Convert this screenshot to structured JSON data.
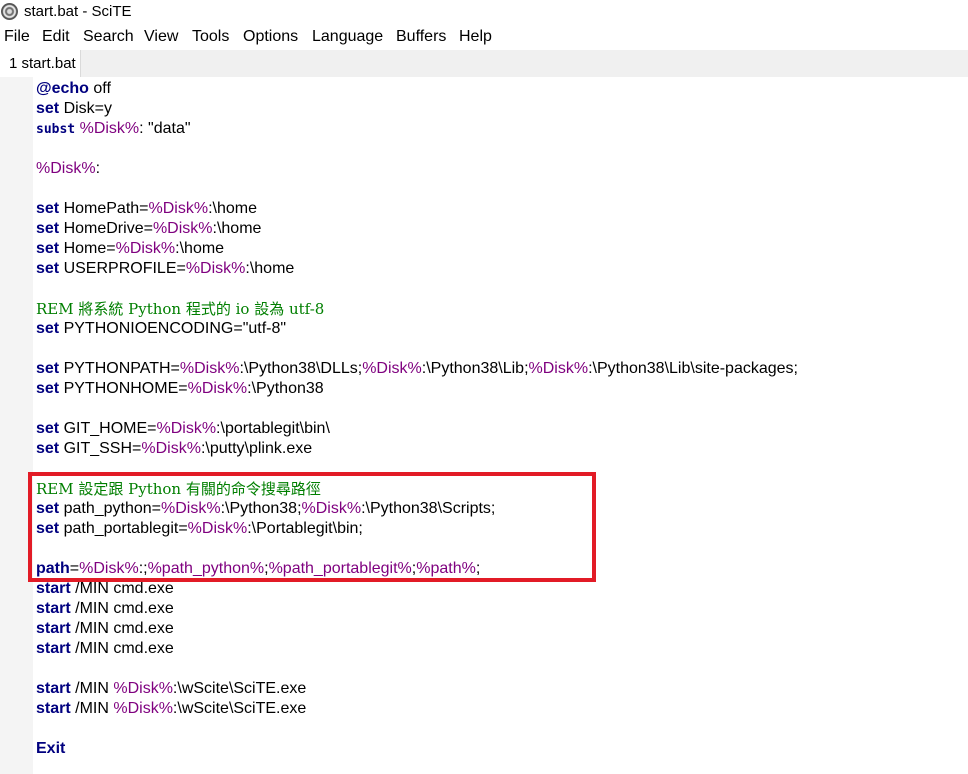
{
  "window": {
    "title": "start.bat - SciTE"
  },
  "menu": {
    "file": "File",
    "edit": "Edit",
    "search": "Search",
    "view": "View",
    "tools": "Tools",
    "options": "Options",
    "language": "Language",
    "buffers": "Buffers",
    "help": "Help"
  },
  "tabs": [
    {
      "label": "1 start.bat"
    }
  ],
  "code": [
    [
      [
        "kw",
        "@echo"
      ],
      [
        "t",
        " off"
      ]
    ],
    [
      [
        "kw",
        "set"
      ],
      [
        "t",
        " Disk=y"
      ]
    ],
    [
      [
        "kw sub",
        "subst"
      ],
      [
        "t",
        " "
      ],
      [
        "var",
        "%Disk%"
      ],
      [
        "t",
        ": \"data\""
      ]
    ],
    [],
    [
      [
        "var",
        "%Disk%"
      ],
      [
        "t",
        ":"
      ]
    ],
    [],
    [
      [
        "kw",
        "set"
      ],
      [
        "t",
        " HomePath="
      ],
      [
        "var",
        "%Disk%"
      ],
      [
        "t",
        ":\\home"
      ]
    ],
    [
      [
        "kw",
        "set"
      ],
      [
        "t",
        " HomeDrive="
      ],
      [
        "var",
        "%Disk%"
      ],
      [
        "t",
        ":\\home"
      ]
    ],
    [
      [
        "kw",
        "set"
      ],
      [
        "t",
        " Home="
      ],
      [
        "var",
        "%Disk%"
      ],
      [
        "t",
        ":\\home"
      ]
    ],
    [
      [
        "kw",
        "set"
      ],
      [
        "t",
        " USERPROFILE="
      ],
      [
        "var",
        "%Disk%"
      ],
      [
        "t",
        ":\\home"
      ]
    ],
    [],
    [
      [
        "rem",
        "REM 將系統 Python 程式的 io 設為 utf-8"
      ]
    ],
    [
      [
        "kw",
        "set"
      ],
      [
        "t",
        " PYTHONIOENCODING=\"utf-8\""
      ]
    ],
    [],
    [
      [
        "kw",
        "set"
      ],
      [
        "t",
        " PYTHONPATH="
      ],
      [
        "var",
        "%Disk%"
      ],
      [
        "t",
        ":\\Python38\\DLLs;"
      ],
      [
        "var",
        "%Disk%"
      ],
      [
        "t",
        ":\\Python38\\Lib;"
      ],
      [
        "var",
        "%Disk%"
      ],
      [
        "t",
        ":\\Python38\\Lib\\site-packages;"
      ]
    ],
    [
      [
        "kw",
        "set"
      ],
      [
        "t",
        " PYTHONHOME="
      ],
      [
        "var",
        "%Disk%"
      ],
      [
        "t",
        ":\\Python38"
      ]
    ],
    [],
    [
      [
        "kw",
        "set"
      ],
      [
        "t",
        " GIT_HOME="
      ],
      [
        "var",
        "%Disk%"
      ],
      [
        "t",
        ":\\portablegit\\bin\\"
      ]
    ],
    [
      [
        "kw",
        "set"
      ],
      [
        "t",
        " GIT_SSH="
      ],
      [
        "var",
        "%Disk%"
      ],
      [
        "t",
        ":\\putty\\plink.exe"
      ]
    ],
    [],
    [
      [
        "rem",
        "REM 設定跟 Python 有關的命令搜尋路徑"
      ]
    ],
    [
      [
        "kw",
        "set"
      ],
      [
        "t",
        " path_python="
      ],
      [
        "var",
        "%Disk%"
      ],
      [
        "t",
        ":\\Python38;"
      ],
      [
        "var",
        "%Disk%"
      ],
      [
        "t",
        ":\\Python38\\Scripts;"
      ]
    ],
    [
      [
        "kw",
        "set"
      ],
      [
        "t",
        " path_portablegit="
      ],
      [
        "var",
        "%Disk%"
      ],
      [
        "t",
        ":\\Portablegit\\bin;"
      ]
    ],
    [],
    [
      [
        "kw",
        "path"
      ],
      [
        "t",
        "="
      ],
      [
        "var",
        "%Disk%"
      ],
      [
        "t",
        ":;"
      ],
      [
        "var",
        "%path_python%"
      ],
      [
        "t",
        ";"
      ],
      [
        "var",
        "%path_portablegit%"
      ],
      [
        "t",
        ";"
      ],
      [
        "var",
        "%path%"
      ],
      [
        "t",
        ";"
      ]
    ],
    [
      [
        "kw",
        "start"
      ],
      [
        "t",
        " /MIN cmd.exe"
      ]
    ],
    [
      [
        "kw",
        "start"
      ],
      [
        "t",
        " /MIN cmd.exe"
      ]
    ],
    [
      [
        "kw",
        "start"
      ],
      [
        "t",
        " /MIN cmd.exe"
      ]
    ],
    [
      [
        "kw",
        "start"
      ],
      [
        "t",
        " /MIN cmd.exe"
      ]
    ],
    [],
    [
      [
        "kw",
        "start"
      ],
      [
        "t",
        " /MIN "
      ],
      [
        "var",
        "%Disk%"
      ],
      [
        "t",
        ":\\wScite\\SciTE.exe"
      ]
    ],
    [
      [
        "kw",
        "start"
      ],
      [
        "t",
        " /MIN "
      ],
      [
        "var",
        "%Disk%"
      ],
      [
        "t",
        ":\\wScite\\SciTE.exe"
      ]
    ],
    [],
    [
      [
        "kw",
        "Exit"
      ]
    ]
  ]
}
